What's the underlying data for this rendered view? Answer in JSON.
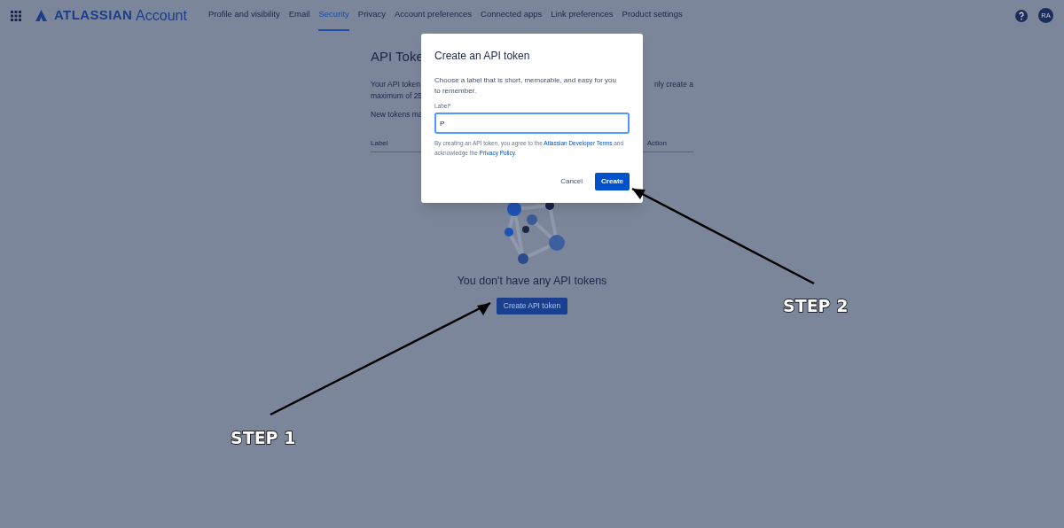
{
  "header": {
    "product": "Account",
    "brand": "ATLASSIAN",
    "nav": [
      {
        "label": "Profile and visibility",
        "selected": false
      },
      {
        "label": "Email",
        "selected": false
      },
      {
        "label": "Security",
        "selected": true
      },
      {
        "label": "Privacy",
        "selected": false
      },
      {
        "label": "Account preferences",
        "selected": false
      },
      {
        "label": "Connected apps",
        "selected": false
      },
      {
        "label": "Link preferences",
        "selected": false
      },
      {
        "label": "Product settings",
        "selected": false
      }
    ],
    "avatar": "RA"
  },
  "page": {
    "title": "API Toke",
    "intro_left": [
      "Your API token",
      "maximum of 25"
    ],
    "intro_right": "nly create a",
    "note": "New tokens ma",
    "columns": [
      "Label",
      "Action"
    ],
    "empty_title": "You don't have any API tokens",
    "create_button": "Create API token"
  },
  "dialog": {
    "title": "Create an API token",
    "description": "Choose a label that is short, memorable, and easy for you to remember.",
    "field_label": "Label",
    "required_mark": "*",
    "field_value": "P",
    "terms_before": "By creating an API token, you agree to the ",
    "terms_link": "Atlassian Developer Terms",
    "terms_middle": " and acknowledge the ",
    "privacy_link": "Privacy Policy",
    "terms_after": ".",
    "cancel": "Cancel",
    "create": "Create"
  },
  "annotations": [
    {
      "label": "STEP 1"
    },
    {
      "label": "STEP 2"
    }
  ]
}
